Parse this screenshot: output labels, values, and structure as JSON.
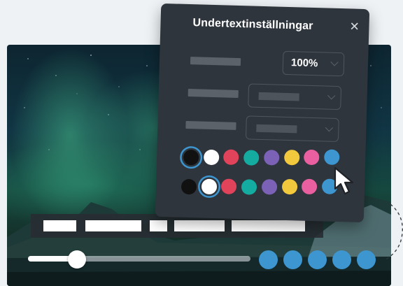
{
  "panel": {
    "title": "Undertextinställningar",
    "close_icon": "close-icon",
    "rows": [
      {
        "value": "100%"
      },
      {
        "value": ""
      },
      {
        "value": ""
      }
    ],
    "text_colors": [
      "#111111",
      "#ffffff",
      "#e0435a",
      "#14aca0",
      "#7b62b6",
      "#f2c93c",
      "#ea5fa0",
      "#3d96cf"
    ],
    "background_colors": [
      "#111111",
      "#ffffff",
      "#e0435a",
      "#14aca0",
      "#7b62b6",
      "#f2c93c",
      "#ea5fa0",
      "#3d96cf"
    ],
    "selected_text_color": "#111111",
    "selected_background_color": "#ffffff"
  },
  "player": {
    "progress": 0.22,
    "accent": "#3d96cf",
    "control_icons": [
      "control-button-icon",
      "control-button-icon",
      "control-button-icon",
      "control-button-icon",
      "control-button-icon"
    ]
  },
  "cursor_icon": "mouse-pointer-icon"
}
